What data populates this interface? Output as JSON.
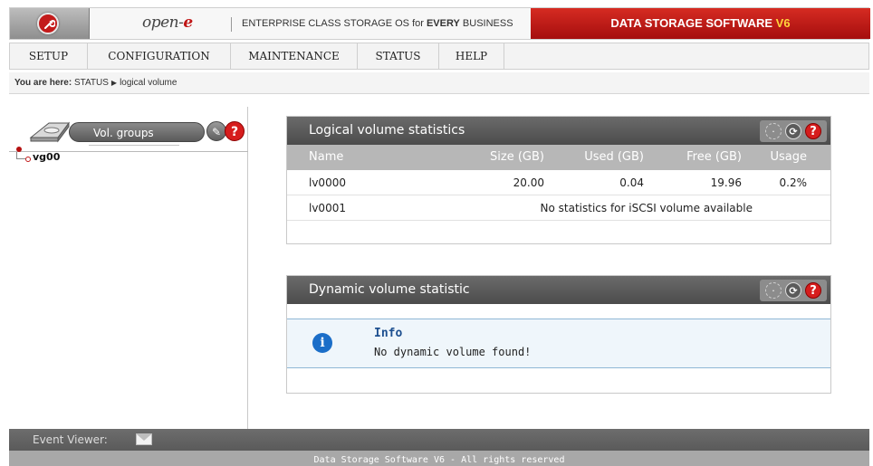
{
  "header": {
    "brand_prefix": "open-",
    "brand_suffix": "e",
    "tagline_main": "ENTERPRISE CLASS STORAGE OS for ",
    "tagline_bold": "EVERY",
    "tagline_end": " BUSINESS",
    "product_name": "DATA STORAGE SOFTWARE ",
    "product_version": "V6",
    "logo_icon": "wrench-icon",
    "colors": {
      "product_bg": "#c31b1b",
      "version": "#ffd53c"
    }
  },
  "menu": {
    "items": [
      {
        "label": "SETUP"
      },
      {
        "label": "CONFIGURATION"
      },
      {
        "label": "MAINTENANCE"
      },
      {
        "label": "STATUS"
      },
      {
        "label": "HELP"
      }
    ]
  },
  "breadcrumb": {
    "prefix": "You are here:",
    "section": "STATUS",
    "page": "logical volume"
  },
  "left_panel": {
    "tab_label": "Vol. groups",
    "tree": [
      {
        "label": "vg00"
      }
    ]
  },
  "stats_panel": {
    "title": "Logical volume statistics",
    "columns": {
      "name": "Name",
      "size": "Size (GB)",
      "used": "Used (GB)",
      "free": "Free (GB)",
      "usage": "Usage"
    },
    "rows": [
      {
        "name": "lv0000",
        "size": "20.00",
        "used": "0.04",
        "free": "19.96",
        "usage": "0.2%"
      },
      {
        "name": "lv0001",
        "note": "No statistics for iSCSI volume available"
      }
    ]
  },
  "dynamic_panel": {
    "title": "Dynamic volume statistic",
    "info_title": "Info",
    "info_message": "No dynamic volume found!"
  },
  "event_viewer": {
    "label": "Event Viewer:"
  },
  "footer": {
    "text": "Data Storage Software V6 - All rights reserved"
  }
}
